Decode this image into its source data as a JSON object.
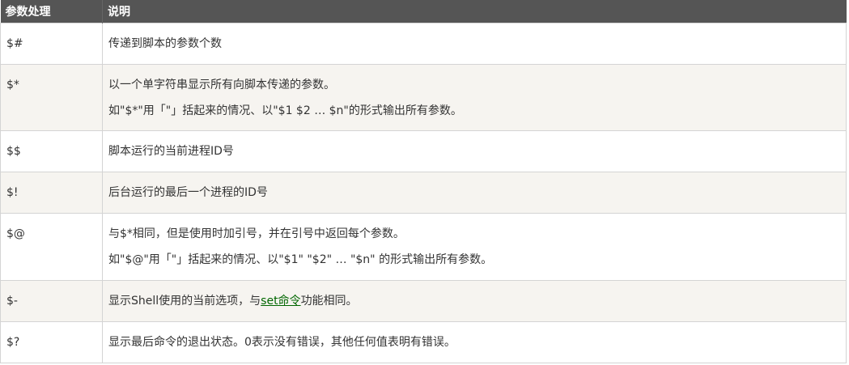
{
  "table": {
    "headers": [
      "参数处理",
      "说明"
    ],
    "rows": [
      {
        "param": "$#",
        "lines": [
          "传递到脚本的参数个数"
        ]
      },
      {
        "param": "$*",
        "lines": [
          "以一个单字符串显示所有向脚本传递的参数。",
          "如\"$*\"用「\"」括起来的情况、以\"$1 $2 … $n\"的形式输出所有参数。"
        ]
      },
      {
        "param": "$$",
        "lines": [
          "脚本运行的当前进程ID号"
        ]
      },
      {
        "param": "$!",
        "lines": [
          "后台运行的最后一个进程的ID号"
        ]
      },
      {
        "param": "$@",
        "lines": [
          "与$*相同，但是使用时加引号，并在引号中返回每个参数。",
          "如\"$@\"用「\"」括起来的情况、以\"$1\" \"$2\" … \"$n\" 的形式输出所有参数。"
        ]
      },
      {
        "param": "$-",
        "before": "显示Shell使用的当前选项，与",
        "link": "set命令",
        "after": "功能相同。"
      },
      {
        "param": "$?",
        "lines": [
          "显示最后命令的退出状态。0表示没有错误，其他任何值表明有错误。"
        ]
      }
    ]
  },
  "colors": {
    "header_bg": "#555555",
    "header_text": "#ffffff",
    "row_alt_bg": "#f6f4f0",
    "link": "#006600"
  }
}
